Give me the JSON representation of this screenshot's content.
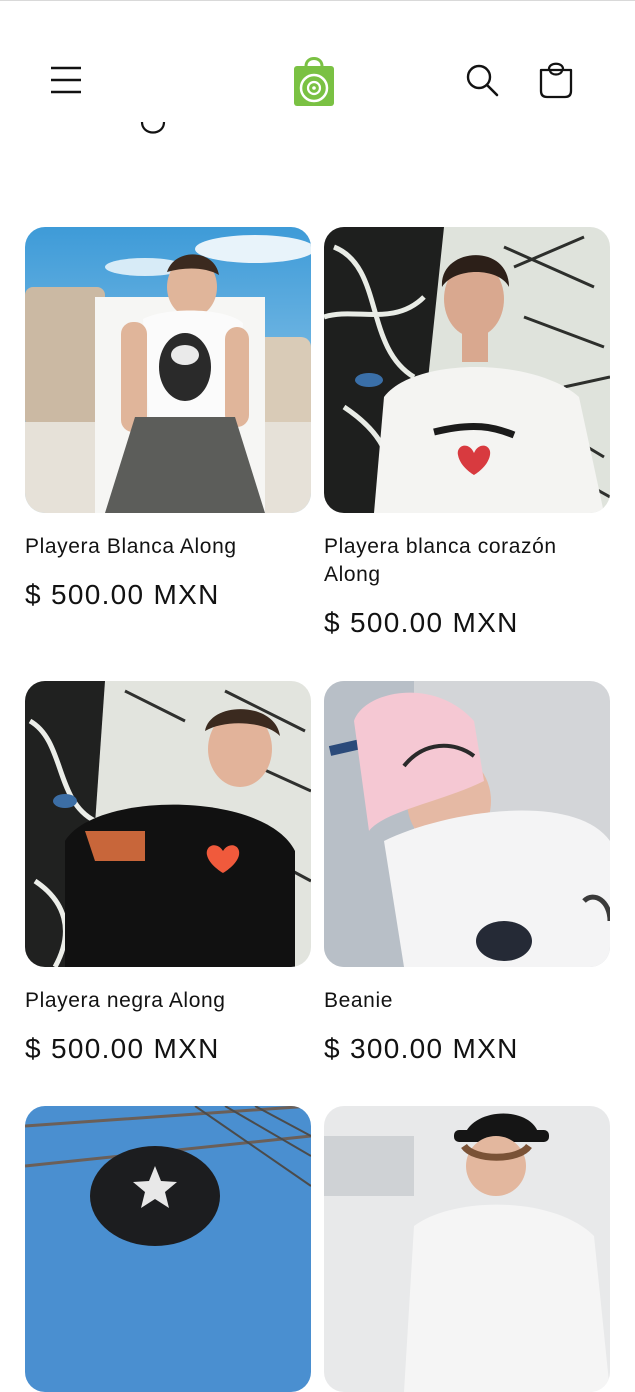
{
  "header": {
    "menu_icon": "hamburger-menu-icon",
    "logo_icon": "shopping-bag-logo-icon",
    "search_icon": "search-icon",
    "cart_icon": "cart-bag-icon",
    "logo_color": "#7ac143"
  },
  "products": [
    {
      "title": "Playera Blanca Along",
      "price": "$ 500.00 MXN"
    },
    {
      "title": "Playera blanca corazón Along",
      "price": "$ 500.00 MXN"
    },
    {
      "title": "Playera negra Along",
      "price": "$ 500.00 MXN"
    },
    {
      "title": "Beanie",
      "price": "$ 300.00 MXN"
    },
    {
      "title": "",
      "price": ""
    },
    {
      "title": "",
      "price": ""
    }
  ]
}
